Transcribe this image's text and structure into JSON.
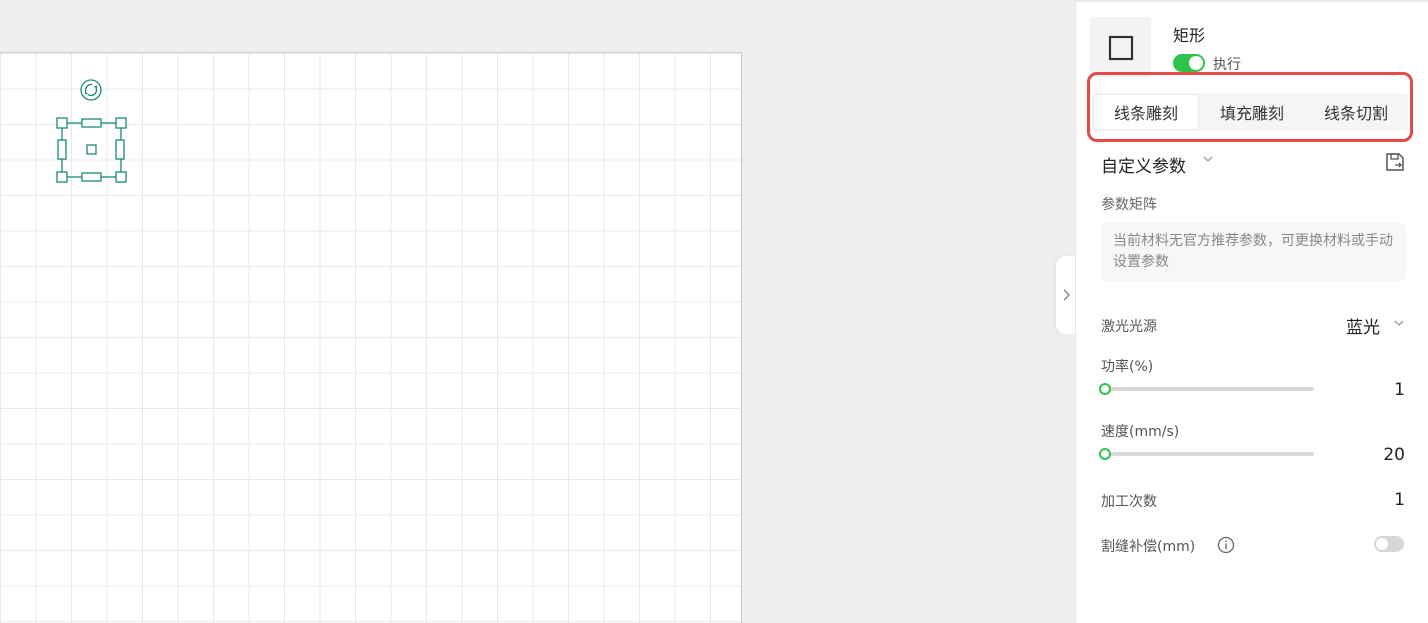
{
  "object": {
    "name": "矩形",
    "execute_label": "执行",
    "execute_enabled": true
  },
  "tabs": [
    {
      "label": "线条雕刻",
      "active": true
    },
    {
      "label": "填充雕刻",
      "active": false
    },
    {
      "label": "线条切割",
      "active": false
    }
  ],
  "preset": {
    "label": "自定义参数"
  },
  "matrix": {
    "title": "参数矩阵",
    "message": "当前材料无官方推荐参数，可更换材料或手动设置参数"
  },
  "laser": {
    "label": "激光光源",
    "value": "蓝光"
  },
  "power": {
    "label": "功率(%)",
    "value": 1,
    "fraction": 0.0
  },
  "speed": {
    "label": "速度(mm/s)",
    "value": 20,
    "fraction": 0.0
  },
  "passes": {
    "label": "加工次数",
    "value": 1
  },
  "kerf": {
    "label": "割缝补偿(mm)",
    "enabled": false
  },
  "colors": {
    "accent": "#2ec34a",
    "selection": "#1a8a7a",
    "highlight_box": "#e34a4a"
  },
  "icons": [
    "rotate-icon",
    "square-shape-icon",
    "chevron-down-icon",
    "save-preset-icon",
    "info-icon",
    "chevron-right-icon"
  ]
}
